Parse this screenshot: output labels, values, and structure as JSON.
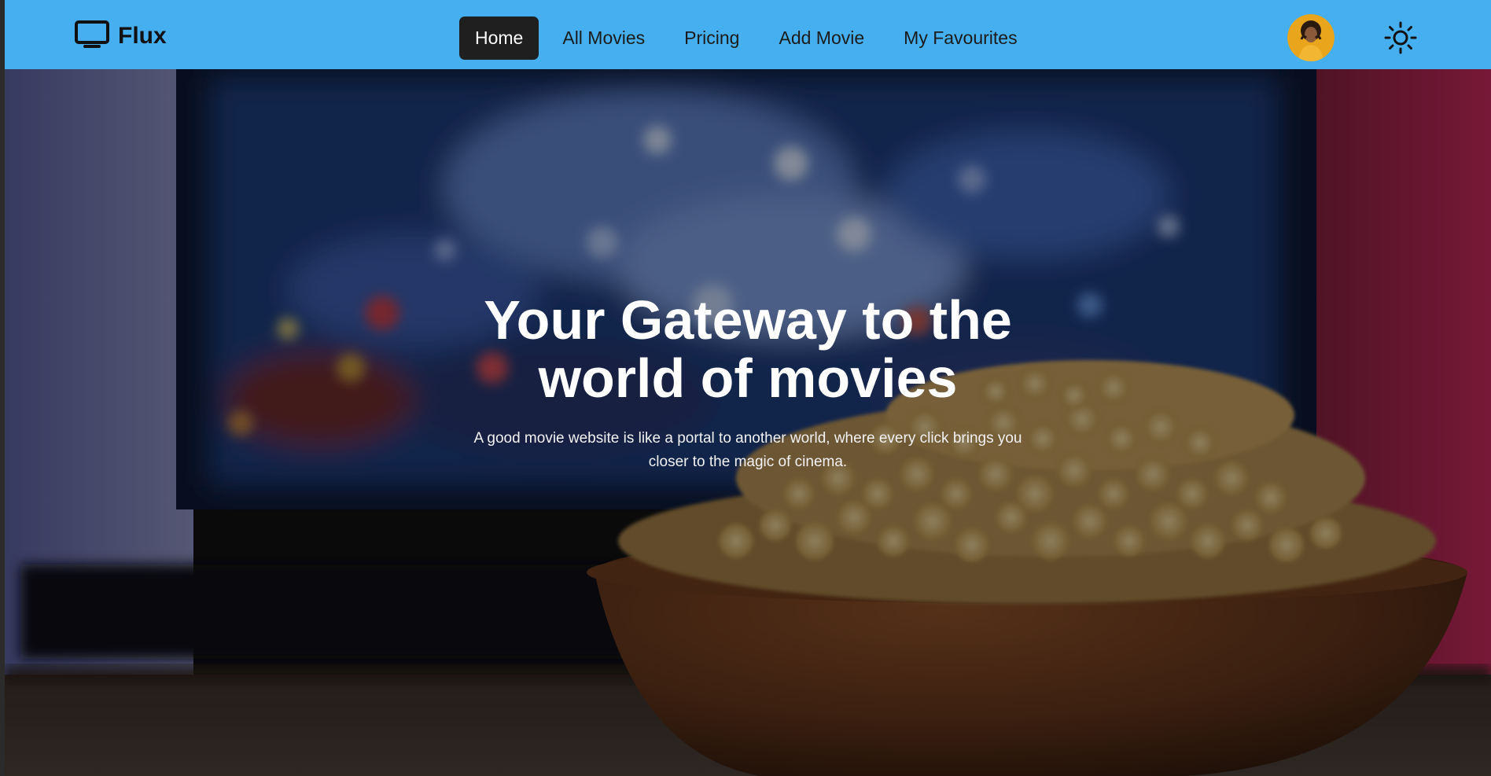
{
  "app": {
    "brand_name": "Flux",
    "brand_icon": "tv-icon"
  },
  "nav": {
    "items": [
      {
        "label": "Home",
        "active": true
      },
      {
        "label": "All Movies",
        "active": false
      },
      {
        "label": "Pricing",
        "active": false
      },
      {
        "label": "Add Movie",
        "active": false
      },
      {
        "label": "My Favourites",
        "active": false
      }
    ]
  },
  "header": {
    "avatar_icon": "user-avatar",
    "theme_icon": "sun-icon"
  },
  "hero": {
    "title": "Your Gateway to the world of movies",
    "subtitle": "A good movie website is like a portal to another world, where every click brings you closer to the magic of cinema.",
    "background": "blurred-tv-and-popcorn-bowl"
  },
  "colors": {
    "navbar": "#45aff0",
    "active_nav": "#1f1f1f",
    "text_dark": "#1b1b1b",
    "hero_text": "#ffffff"
  }
}
